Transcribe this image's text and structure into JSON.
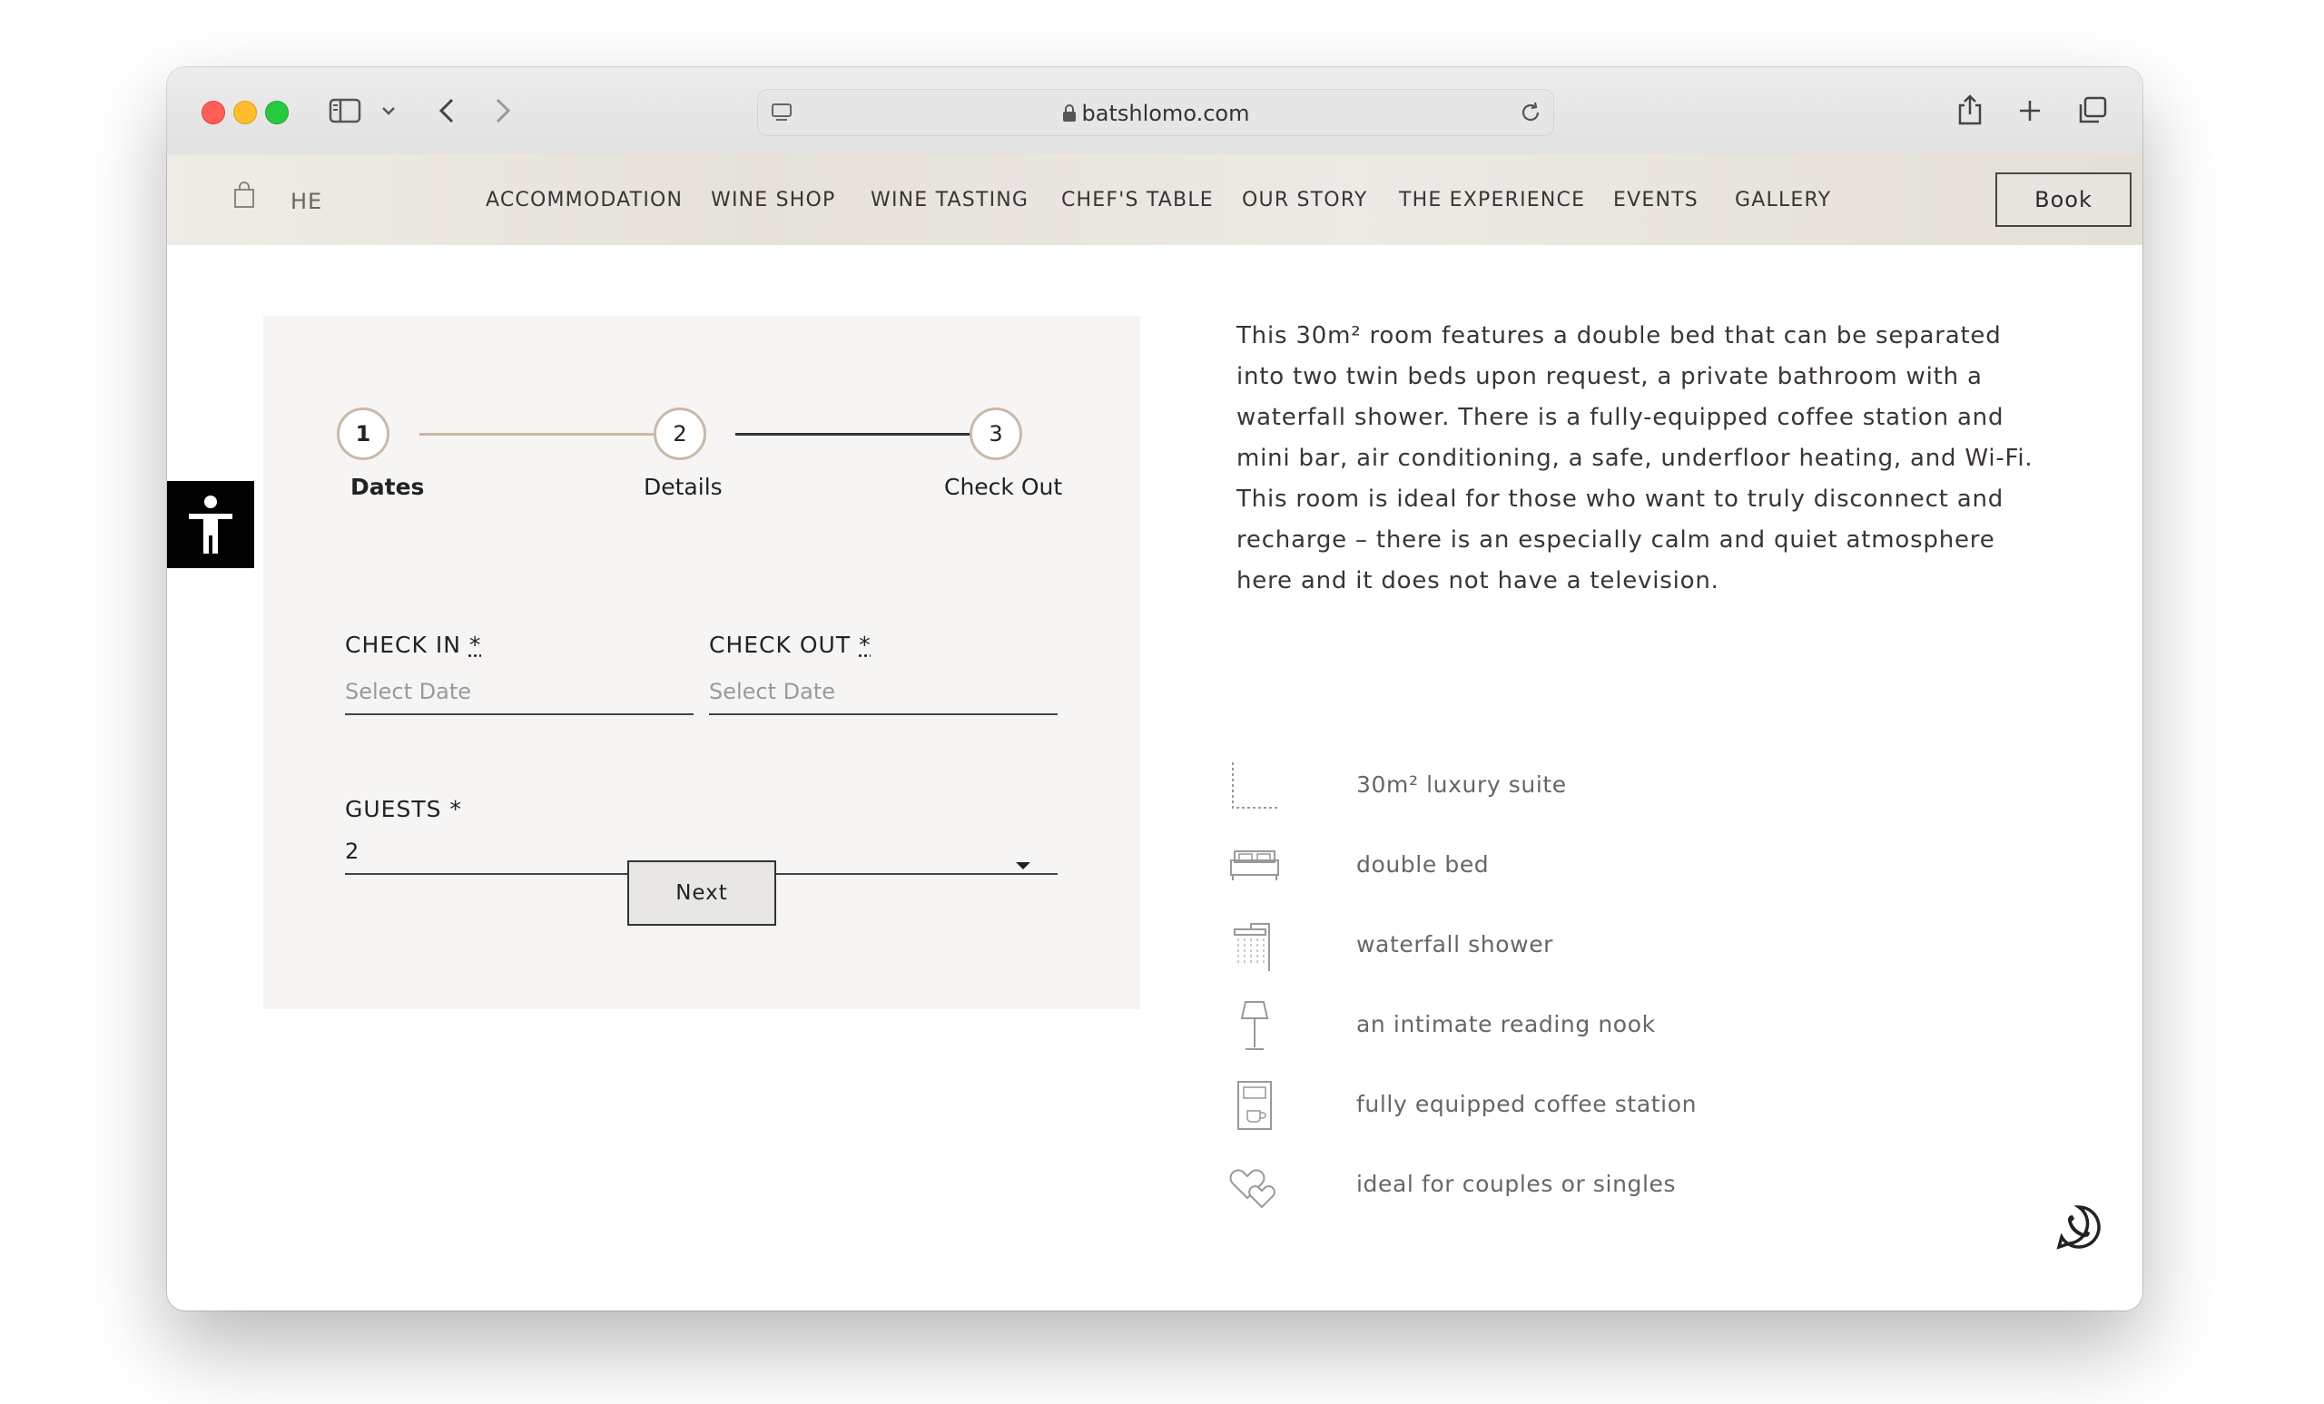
{
  "browser": {
    "url": "batshlomo.com"
  },
  "header": {
    "lang": "HE",
    "nav": [
      "ACCOMMODATION",
      "WINE SHOP",
      "WINE TASTING",
      "CHEF'S TABLE",
      "OUR STORY",
      "THE EXPERIENCE",
      "EVENTS",
      "GALLERY"
    ],
    "book_label": "Book"
  },
  "booking": {
    "steps": [
      {
        "number": "1",
        "label": "Dates"
      },
      {
        "number": "2",
        "label": "Details"
      },
      {
        "number": "3",
        "label": "Check Out"
      }
    ],
    "check_in": {
      "label": "CHECK IN",
      "required": "*",
      "placeholder": "Select Date"
    },
    "check_out": {
      "label": "CHECK OUT",
      "required": "*",
      "placeholder": "Select Date"
    },
    "guests": {
      "label": "GUESTS *",
      "value": "2"
    },
    "next_label": "Next"
  },
  "room": {
    "description": "This 30m² room features a double bed that can be separated into two twin beds upon request, a private bathroom with a waterfall shower. There is a fully-equipped coffee station and mini bar, air conditioning, a safe, underfloor heating, and Wi-Fi. This room is ideal for those who want to truly disconnect and recharge – there is an especially calm and quiet atmosphere here and it does not have a television.",
    "features": [
      {
        "icon": "floor-area-icon",
        "label": "30m² luxury suite"
      },
      {
        "icon": "bed-icon",
        "label": "double bed"
      },
      {
        "icon": "shower-icon",
        "label": "waterfall shower"
      },
      {
        "icon": "lamp-icon",
        "label": "an intimate reading nook"
      },
      {
        "icon": "coffee-machine-icon",
        "label": "fully equipped coffee station"
      },
      {
        "icon": "hearts-icon",
        "label": "ideal for couples or singles"
      }
    ]
  }
}
